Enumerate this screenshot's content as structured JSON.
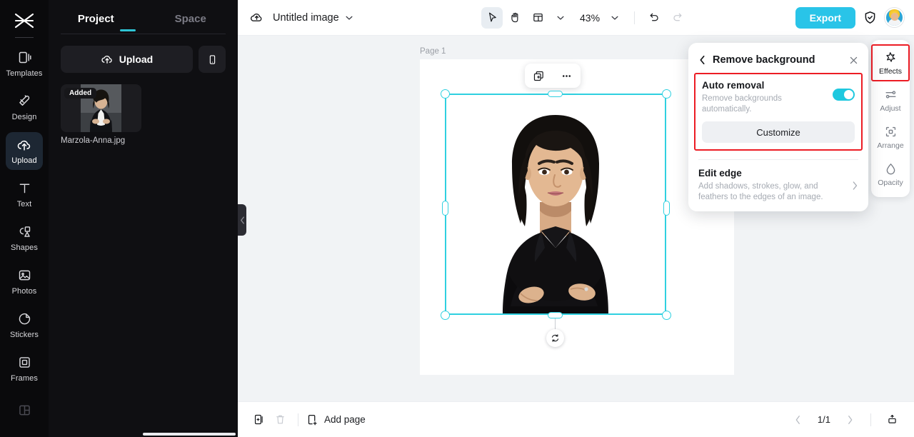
{
  "colors": {
    "accent_teal": "#2fd0e0",
    "export_blue": "#29c4e8",
    "highlight_red": "#ec1c24",
    "rail_bg": "#0a0a0c",
    "panel_bg": "#0f0f12",
    "canvas_bg": "#f1f3f5"
  },
  "left_rail": {
    "logo_icon": "capcut-logo-icon",
    "items": [
      {
        "label": "Templates",
        "icon": "templates-icon",
        "active": false
      },
      {
        "label": "Design",
        "icon": "design-icon",
        "active": false
      },
      {
        "label": "Upload",
        "icon": "upload-cloud-icon",
        "active": true
      },
      {
        "label": "Text",
        "icon": "text-icon",
        "active": false
      },
      {
        "label": "Shapes",
        "icon": "shapes-icon",
        "active": false
      },
      {
        "label": "Photos",
        "icon": "photos-icon",
        "active": false
      },
      {
        "label": "Stickers",
        "icon": "stickers-icon",
        "active": false
      },
      {
        "label": "Frames",
        "icon": "frames-icon",
        "active": false
      },
      {
        "label": "",
        "icon": "layout-grid-icon",
        "active": false
      }
    ]
  },
  "panel": {
    "tabs": [
      {
        "label": "Project",
        "active": true
      },
      {
        "label": "Space",
        "active": false
      }
    ],
    "upload_button_label": "Upload",
    "upload_icon": "upload-cloud-icon",
    "mobile_upload_icon": "mobile-phone-icon",
    "assets": [
      {
        "name": "Marzola-Anna.jpg",
        "badge": "Added"
      }
    ],
    "collapse_icon": "chevron-left-icon"
  },
  "topbar": {
    "cloud_icon": "cloud-sync-icon",
    "document_title": "Untitled image",
    "title_caret_icon": "chevron-down-icon",
    "tools": [
      {
        "name": "select-tool",
        "icon": "cursor-arrow-icon",
        "active": true
      },
      {
        "name": "hand-tool",
        "icon": "hand-icon",
        "active": false
      },
      {
        "name": "layout-tool",
        "icon": "layout-panel-icon",
        "active": false
      }
    ],
    "layout_caret_icon": "chevron-down-icon",
    "zoom_level": "43%",
    "zoom_caret_icon": "chevron-down-icon",
    "undo_icon": "undo-arrow-icon",
    "redo_icon": "redo-arrow-icon",
    "export_label": "Export",
    "shield_icon": "shield-check-icon",
    "avatar_name": "user-avatar"
  },
  "canvas": {
    "page_label": "Page 1",
    "float_toolbar": [
      {
        "name": "duplicate-layer-button",
        "icon": "duplicate-plus-icon"
      },
      {
        "name": "more-options-button",
        "icon": "ellipsis-icon"
      }
    ],
    "rotate_icon": "rotate-handle-icon",
    "selection_color": "#2fd0e0"
  },
  "popover": {
    "back_icon": "chevron-left-icon",
    "title": "Remove background",
    "close_icon": "close-x-icon",
    "auto_removal": {
      "title": "Auto removal",
      "description": "Remove backgrounds automatically.",
      "toggle_on": true,
      "customize_label": "Customize"
    },
    "edit_edge": {
      "title": "Edit edge",
      "description": "Add shadows, strokes, glow, and feathers to the edges of an image.",
      "chevron_icon": "chevron-right-icon"
    }
  },
  "right_rail": {
    "items": [
      {
        "label": "Effects",
        "icon": "effects-sparkle-icon",
        "selected": true
      },
      {
        "label": "Adjust",
        "icon": "sliders-icon",
        "selected": false
      },
      {
        "label": "Arrange",
        "icon": "arrange-icon",
        "selected": false
      },
      {
        "label": "Opacity",
        "icon": "opacity-droplet-icon",
        "selected": false
      }
    ]
  },
  "bottombar": {
    "duplicate_page_icon": "duplicate-page-icon",
    "delete_page_icon": "trash-icon",
    "add_page_icon": "add-page-icon",
    "add_page_label": "Add page",
    "prev_page_icon": "chevron-left-icon",
    "page_indicator": "1/1",
    "next_page_icon": "chevron-right-icon",
    "timeline_icon": "expand-timeline-icon"
  }
}
